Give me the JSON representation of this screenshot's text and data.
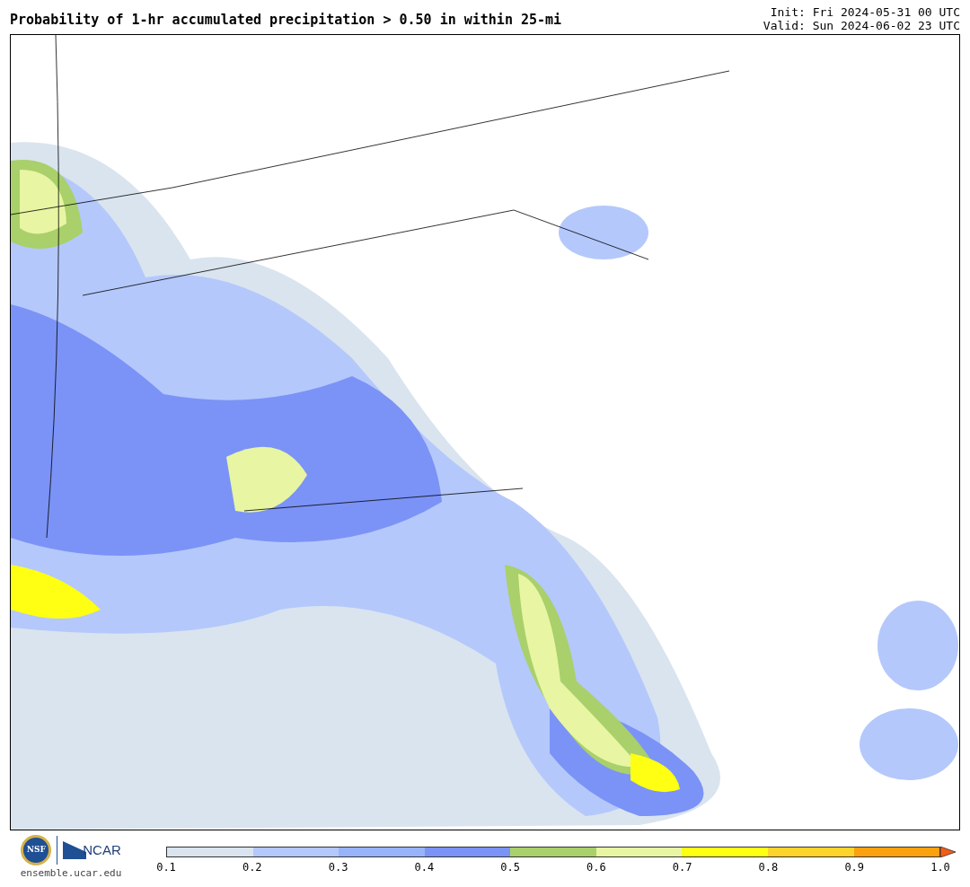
{
  "title": "Probability of 1-hr accumulated precipitation > 0.50 in within 25-mi",
  "init": "Init: Fri 2024-05-31 00 UTC",
  "valid": "Valid: Sun 2024-06-02 23 UTC",
  "logos": {
    "nsf": "NSF",
    "ncar": "NCAR",
    "site": "ensemble.ucar.edu"
  },
  "colorbar": {
    "segments": [
      {
        "color": "#d9e4ef"
      },
      {
        "color": "#b4c8fb"
      },
      {
        "color": "#97b3fa"
      },
      {
        "color": "#7b93f6"
      },
      {
        "color": "#a9d06a"
      },
      {
        "color": "#e8f5a3"
      },
      {
        "color": "#ffff14"
      },
      {
        "color": "#ffd42a"
      },
      {
        "color": "#fca10e"
      },
      {
        "kind": "arrow",
        "color": "#f25c14"
      }
    ],
    "ticks": [
      "0.1",
      "0.2",
      "0.3",
      "0.4",
      "0.5",
      "0.6",
      "0.7",
      "0.8",
      "0.9",
      "1.0"
    ]
  }
}
